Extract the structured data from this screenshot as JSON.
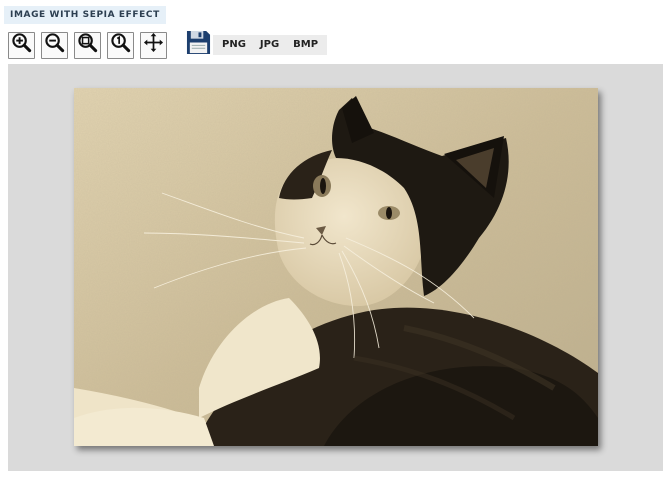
{
  "header": {
    "title": "IMAGE WITH SEPIA EFFECT"
  },
  "toolbar": {
    "tools": [
      {
        "name": "zoom-in",
        "icon": "zoom-in-icon"
      },
      {
        "name": "zoom-out",
        "icon": "zoom-out-icon"
      },
      {
        "name": "zoom-fit",
        "icon": "zoom-fit-icon"
      },
      {
        "name": "zoom-actual",
        "icon": "zoom-actual-size-icon"
      },
      {
        "name": "pan",
        "icon": "move-arrows-icon"
      }
    ],
    "save_icon": "floppy-disk-icon",
    "formats": [
      "PNG",
      "JPG",
      "BMP"
    ]
  },
  "image": {
    "subject": "black-and-white cat lying down, sepia toned",
    "filter": "sepia"
  },
  "colors": {
    "title_bg": "#e6f0f8",
    "title_text": "#2c3e50",
    "canvas_bg": "#dadada",
    "sepia_light": "#e9dcbd",
    "sepia_dark": "#1c1710"
  }
}
